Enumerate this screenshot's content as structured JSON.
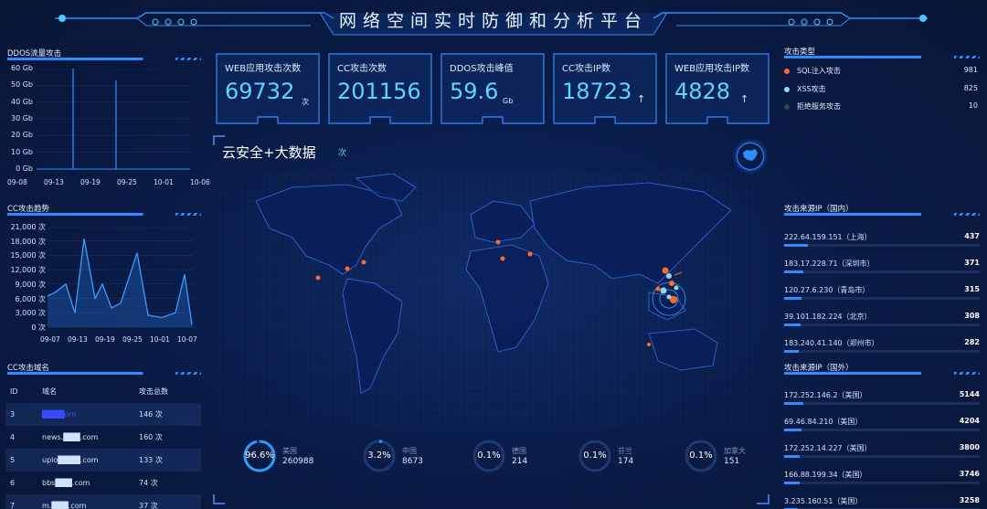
{
  "header": {
    "title": "网络空间实时防御和分析平台"
  },
  "ddos_panel": {
    "title": "DDOS流量攻击",
    "y_ticks": [
      "60 Gb",
      "50 Gb",
      "40 Gb",
      "30 Gb",
      "20 Gb",
      "10 Gb",
      "0 Gb"
    ],
    "x_ticks": [
      "09-08",
      "09-13",
      "09-19",
      "09-25",
      "10-01",
      "10-06"
    ]
  },
  "cc_panel": {
    "title": "CC攻击趋势",
    "y_ticks": [
      "21,000 次",
      "18,000 次",
      "15,000 次",
      "12,000 次",
      "9,000 次",
      "6,000 次",
      "3,000 次",
      "0 次"
    ],
    "x_ticks": [
      "09-07",
      "09-13",
      "09-19",
      "09-25",
      "10-01",
      "10-07"
    ]
  },
  "domain_panel": {
    "title": "CC攻击域名",
    "headers": [
      "ID",
      "域名",
      "攻击总数"
    ],
    "rows": [
      {
        "id": "3",
        "domain": "████om",
        "count": "146 次"
      },
      {
        "id": "4",
        "domain": "news.███.com",
        "count": "160 次"
      },
      {
        "id": "5",
        "domain": "uplo████.com",
        "count": "133 次"
      },
      {
        "id": "6",
        "domain": "bbs███.com",
        "count": "74 次"
      },
      {
        "id": "7",
        "domain": "m.███.com",
        "count": "37 次"
      }
    ]
  },
  "stats": [
    {
      "label": "WEB应用攻击次数",
      "value": "69732",
      "unit": "次"
    },
    {
      "label": "CC攻击次数",
      "value": "201156",
      "unit": ""
    },
    {
      "label": "DDOS攻击峰值",
      "value": "59.6",
      "unit": "Gb"
    },
    {
      "label": "CC攻击IP数",
      "value": "18723",
      "unit": "↑"
    },
    {
      "label": "WEB应用攻击IP数",
      "value": "4828",
      "unit": "↑"
    }
  ],
  "map": {
    "title": "云安全+大数据",
    "subtitle": "次"
  },
  "rings": [
    {
      "pct": "96.6%",
      "country": "美国",
      "count": "260988",
      "fraction": 0.966
    },
    {
      "pct": "3.2%",
      "country": "中国",
      "count": "8673",
      "fraction": 0.032
    },
    {
      "pct": "0.1%",
      "country": "德国",
      "count": "214",
      "fraction": 0.001
    },
    {
      "pct": "0.1%",
      "country": "芬兰",
      "count": "174",
      "fraction": 0.001
    },
    {
      "pct": "0.1%",
      "country": "加拿大",
      "count": "151",
      "fraction": 0.001
    }
  ],
  "attack_types": {
    "title": "攻击类型",
    "items": [
      {
        "label": "SQL注入攻击",
        "value": "981",
        "color": "#ff6a2a"
      },
      {
        "label": "XSS攻击",
        "value": "825",
        "color": "#8fd8e8"
      },
      {
        "label": "拒绝服务攻击",
        "value": "10",
        "color": "#2a4a3a"
      }
    ]
  },
  "domestic": {
    "title": "攻击来源IP（国内）",
    "rows": [
      {
        "label": "222.64.159.151（上海）",
        "value": "437",
        "fraction": 0.12
      },
      {
        "label": "183.17.228.71（深圳市）",
        "value": "371",
        "fraction": 0.1
      },
      {
        "label": "120.27.6.230（青岛市）",
        "value": "315",
        "fraction": 0.09
      },
      {
        "label": "39.101.182.224（北京）",
        "value": "308",
        "fraction": 0.085
      },
      {
        "label": "183.240.41.140（郑州市）",
        "value": "282",
        "fraction": 0.075
      }
    ]
  },
  "foreign": {
    "title": "攻击来源IP（国外）",
    "rows": [
      {
        "label": "172.252.146.2（美国）",
        "value": "5144",
        "fraction": 0.1
      },
      {
        "label": "69.46.84.210（美国）",
        "value": "4204",
        "fraction": 0.09
      },
      {
        "label": "172.252.14.227（美国）",
        "value": "3800",
        "fraction": 0.08
      },
      {
        "label": "166.88.199.34（美国）",
        "value": "3746",
        "fraction": 0.08
      },
      {
        "label": "3.235.160.51（美国）",
        "value": "3258",
        "fraction": 0.07
      }
    ]
  },
  "chart_data": [
    {
      "type": "line",
      "title": "DDOS流量攻击",
      "x": [
        "09-08",
        "09-13",
        "09-19",
        "09-25",
        "10-01",
        "10-06"
      ],
      "series": [
        {
          "values": [
            0,
            60,
            0,
            53,
            0,
            0
          ]
        }
      ],
      "ylabel": "",
      "ylim": [
        0,
        60
      ]
    },
    {
      "type": "area",
      "title": "CC攻击趋势",
      "x": [
        "09-07",
        "09-13",
        "09-19",
        "09-25",
        "10-01",
        "10-07"
      ],
      "series": [
        {
          "values": [
            7000,
            18500,
            9000,
            15500,
            11000,
            500
          ]
        }
      ],
      "ylim": [
        0,
        21000
      ]
    }
  ]
}
